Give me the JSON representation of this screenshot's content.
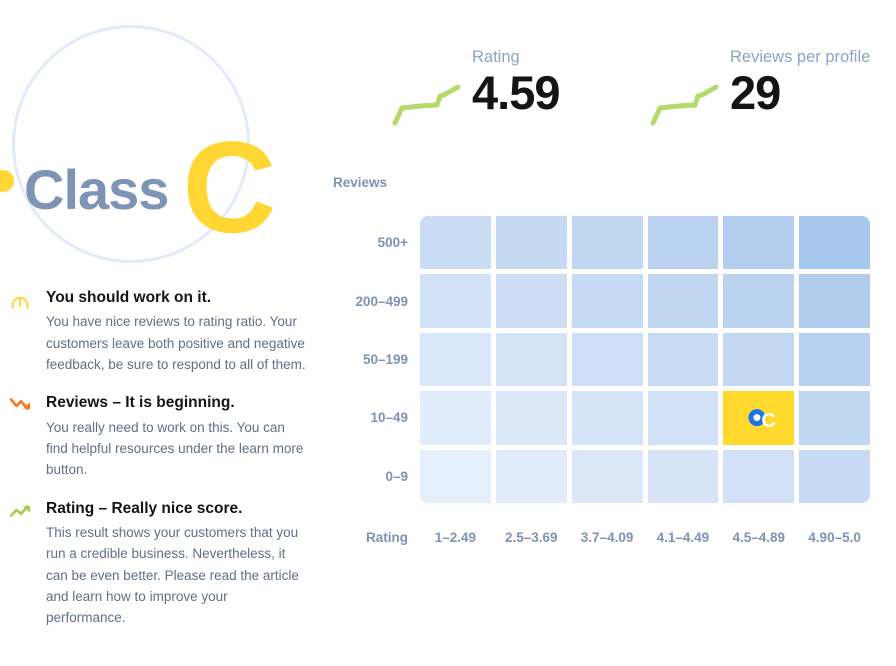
{
  "badge": {
    "word": "Class",
    "letter": "C",
    "dot_color": "#ffd633",
    "letter_color": "#ffd633",
    "word_color": "#7e94b4",
    "ring_color": "#e3ebfa"
  },
  "metrics": [
    {
      "id": "rating",
      "label": "Rating",
      "value": "4.59",
      "spark_color": "#b5d96a",
      "icon": "sparkline-up-icon"
    },
    {
      "id": "reviews",
      "label": "Reviews per profile",
      "value": "29",
      "spark_color": "#b5d96a",
      "icon": "sparkline-up-icon"
    }
  ],
  "advice": [
    {
      "icon": "gauge-icon",
      "icon_color": "#ffd633",
      "title": "You should work on it.",
      "description": "You have nice reviews to rating ratio. Your customers leave both positive and negative feedback, be sure to respond to all of them."
    },
    {
      "icon": "trend-down-icon",
      "icon_color": "#f47b20",
      "title": "Reviews – It is beginning.",
      "description": "You really need to work on this. You can find helpful resources under the learn more button."
    },
    {
      "icon": "trend-up-icon",
      "icon_color": "#a5d14e",
      "title": "Rating – Really nice score.",
      "description": "This result shows your customers that you run a credible business. Nevertheless, it can be even better. Please read the article and learn how to improve your performance."
    }
  ],
  "chart_data": {
    "type": "heatmap",
    "title": "",
    "xlabel": "Rating",
    "ylabel": "Reviews",
    "grid": false,
    "legend": "none",
    "categories": [
      "1–2.49",
      "2.5–3.69",
      "3.7–4.09",
      "4.1–4.49",
      "4.5–4.89",
      "4.90–5.0"
    ],
    "rows": [
      "500+",
      "200–499",
      "50–199",
      "10–49",
      "0–9"
    ],
    "cell_colors": [
      [
        "#cbddf4",
        "#c5d9f2",
        "#c0d6f1",
        "#bad2ef",
        "#b3cdee",
        "#a8c7ec"
      ],
      [
        "#d2e2f6",
        "#cddef4",
        "#c7daf3",
        "#c1d7f1",
        "#bbd2ef",
        "#b1cced"
      ],
      [
        "#dae7f8",
        "#d4e3f6",
        "#cfdff5",
        "#c9dbf3",
        "#c3d7f2",
        "#b9d1ef"
      ],
      [
        "#e1ecfa",
        "#dce8f8",
        "#d6e4f7",
        "#d0e0f5",
        "#ffd92e",
        "#c1d6f1"
      ],
      [
        "#e5eefb",
        "#e1ebfa",
        "#dce8f8",
        "#d7e4f7",
        "#d1e0f5",
        "#c8daf3"
      ]
    ],
    "highlight": {
      "row": "10–49",
      "column": "4.5–4.89",
      "label": "C",
      "cell_color": "#ffd92e",
      "marker_color": "#1a73e8",
      "marker_inner_color": "#ffffff",
      "label_color": "#ffffff"
    }
  }
}
